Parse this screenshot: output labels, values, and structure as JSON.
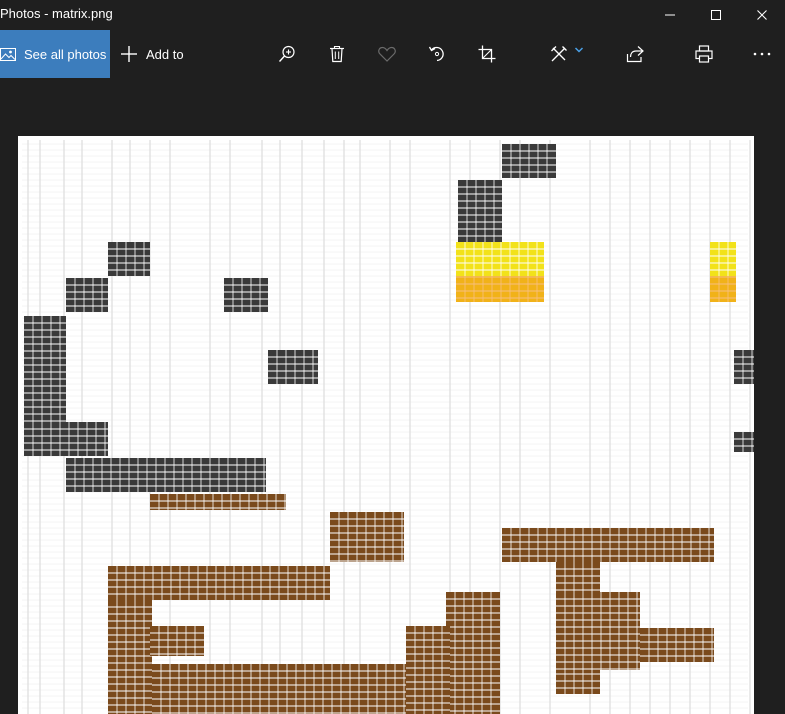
{
  "window": {
    "title": "Photos - matrix.png"
  },
  "toolbar": {
    "see_all_label": "See all photos",
    "add_to_label": "Add to"
  },
  "icons": {
    "photos": "photos-icon",
    "add": "plus-icon",
    "zoom": "zoom-in-icon",
    "delete": "trash-icon",
    "favorite": "heart-icon",
    "rotate": "rotate-icon",
    "crop": "crop-icon",
    "edit": "edit-create-icon",
    "share": "share-icon",
    "print": "print-icon",
    "more": "more-icon"
  },
  "colors": {
    "accent": "#3c7dbd",
    "background": "#1f1f1f",
    "foreground": "#ffffff",
    "disabled_icon": "#6b6b6b",
    "edit_chevron": "#4aa0e6",
    "cell_dark": "#3a3a3a",
    "cell_brown": "#7a4a1c",
    "cell_yellow": "#f2e21a",
    "cell_orange": "#f08a1a"
  },
  "image": {
    "filename": "matrix.png"
  }
}
